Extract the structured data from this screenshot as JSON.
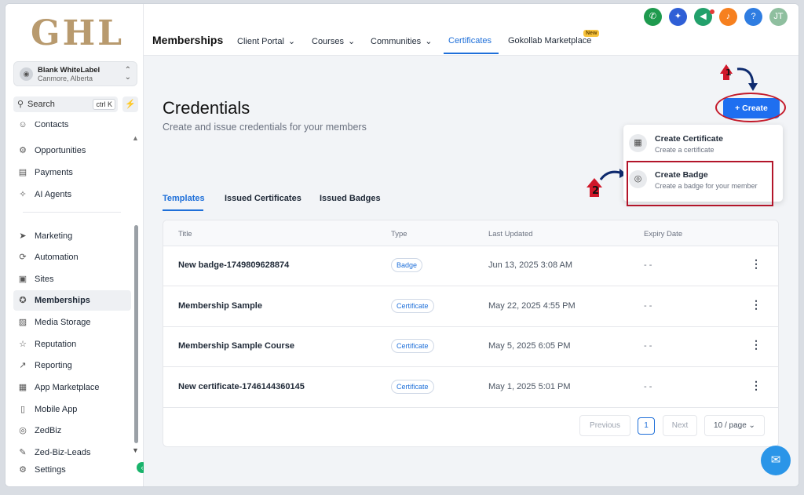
{
  "logo": "GHL",
  "account": {
    "name": "Blank WhiteLabel",
    "location": "Canmore, Alberta"
  },
  "search": {
    "label": "Search",
    "shortcut": "ctrl K"
  },
  "sidebar": {
    "items": [
      {
        "label": "Contacts",
        "icon": "contacts-icon",
        "glyph": "☺"
      },
      {
        "label": "Opportunities",
        "icon": "opportunities-icon",
        "glyph": "⚙"
      },
      {
        "label": "Payments",
        "icon": "payments-icon",
        "glyph": "▤"
      },
      {
        "label": "AI Agents",
        "icon": "sparkle-icon",
        "glyph": "✧"
      },
      {
        "label": "Marketing",
        "icon": "send-icon",
        "glyph": "➤"
      },
      {
        "label": "Automation",
        "icon": "automation-icon",
        "glyph": "⟳"
      },
      {
        "label": "Sites",
        "icon": "sites-icon",
        "glyph": "▣"
      },
      {
        "label": "Memberships",
        "icon": "award-icon",
        "glyph": "✪"
      },
      {
        "label": "Media Storage",
        "icon": "image-icon",
        "glyph": "▨"
      },
      {
        "label": "Reputation",
        "icon": "star-icon",
        "glyph": "☆"
      },
      {
        "label": "Reporting",
        "icon": "trend-icon",
        "glyph": "↗"
      },
      {
        "label": "App Marketplace",
        "icon": "grid-icon",
        "glyph": "▦"
      },
      {
        "label": "Mobile App",
        "icon": "mobile-icon",
        "glyph": "▯"
      },
      {
        "label": "ZedBiz",
        "icon": "zedbiz-icon",
        "glyph": "◎"
      },
      {
        "label": "Zed-Biz-Leads",
        "icon": "wrench-icon",
        "glyph": "✎"
      },
      {
        "label": "Settings",
        "icon": "gear-icon",
        "glyph": "⚙"
      }
    ]
  },
  "topbar": {
    "title": "Memberships",
    "tabs": [
      {
        "label": "Client Portal",
        "chevron": "⌄"
      },
      {
        "label": "Courses",
        "chevron": "⌄"
      },
      {
        "label": "Communities",
        "chevron": "⌄"
      },
      {
        "label": "Certificates",
        "chevron": ""
      },
      {
        "label": "Gokollab Marketplace",
        "chevron": ""
      }
    ],
    "new_badge": "New",
    "user_initials": "JT",
    "help": "?"
  },
  "page": {
    "title": "Credentials",
    "subtitle": "Create and issue credentials for your members",
    "create_label": "+ Create"
  },
  "annotations": [
    "1",
    "2"
  ],
  "dropdown": {
    "items": [
      {
        "title": "Create Certificate",
        "subtitle": "Create a certificate"
      },
      {
        "title": "Create Badge",
        "subtitle": "Create a badge for your member"
      }
    ]
  },
  "content_tabs": [
    "Templates",
    "Issued Certificates",
    "Issued Badges"
  ],
  "table": {
    "headers": [
      "Title",
      "Type",
      "Last Updated",
      "Expiry Date"
    ],
    "rows": [
      {
        "title": "New badge-1749809628874",
        "type": "Badge",
        "updated": "Jun 13, 2025 3:08 AM",
        "expiry": "- -"
      },
      {
        "title": "Membership Sample",
        "type": "Certificate",
        "updated": "May 22, 2025 4:55 PM",
        "expiry": "- -"
      },
      {
        "title": "Membership Sample Course",
        "type": "Certificate",
        "updated": "May 5, 2025 6:05 PM",
        "expiry": "- -"
      },
      {
        "title": "New certificate-1746144360145",
        "type": "Certificate",
        "updated": "May 1, 2025 5:01 PM",
        "expiry": "- -"
      }
    ]
  },
  "pagination": {
    "previous": "Previous",
    "page": "1",
    "next": "Next",
    "per_page": "10 / page"
  },
  "colors": {
    "primary": "#1f6ff0",
    "annotation_red": "#c41a2a",
    "logo_gold": "#b89a6e"
  }
}
